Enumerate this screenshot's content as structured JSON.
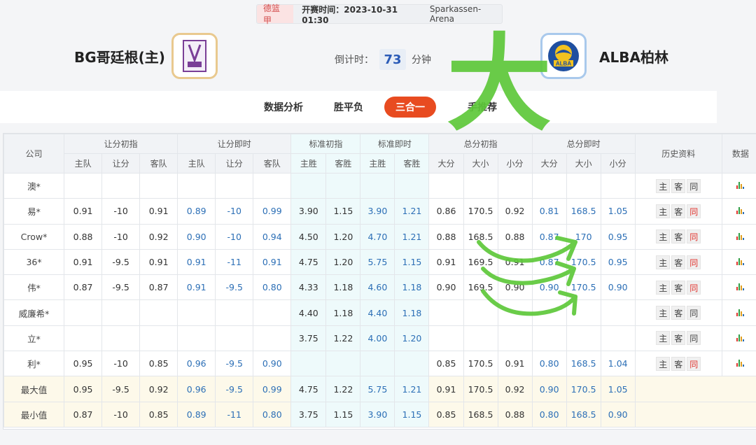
{
  "match": {
    "league": "德篮甲",
    "kickoff_label": "开赛时间：",
    "kickoff": "2023-10-31 01:30",
    "venue": "Sparkassen-Arena"
  },
  "home": {
    "name": "BG哥廷根(主)"
  },
  "away": {
    "name": "ALBA柏林",
    "logo_text": "ALBA"
  },
  "countdown": {
    "label": "倒计时：",
    "value": "73",
    "unit": "分钟"
  },
  "tabs": [
    {
      "label": "数据分析",
      "active": false
    },
    {
      "label": "胜平负",
      "active": false
    },
    {
      "label": "三合一",
      "active": true
    },
    {
      "label": "手推荐",
      "active": false
    }
  ],
  "annotation": {
    "text": "大",
    "color": "#5ec83a"
  },
  "table": {
    "groups": [
      "公司",
      "让分初指",
      "让分即时",
      "标准初指",
      "标准即时",
      "总分初指",
      "总分即时",
      "历史资料",
      "数据"
    ],
    "subheaders": [
      "主队",
      "让分",
      "客队",
      "主队",
      "让分",
      "客队",
      "主胜",
      "客胜",
      "主胜",
      "客胜",
      "大分",
      "大小",
      "小分",
      "大分",
      "大小",
      "小分"
    ],
    "history_buttons": [
      "主",
      "客",
      "同"
    ],
    "rows": [
      {
        "company": "澳*",
        "cells": [
          "",
          "",
          "",
          "",
          "",
          "",
          "",
          "",
          "",
          "",
          "",
          "",
          "",
          "",
          "",
          ""
        ]
      },
      {
        "company": "易*",
        "cells": [
          "0.91",
          "-10",
          "0.91",
          "0.89",
          "-10",
          "0.99",
          "3.90",
          "1.15",
          "3.90",
          "1.21",
          "0.86",
          "170.5",
          "0.92",
          "0.81",
          "168.5",
          "1.05"
        ]
      },
      {
        "company": "Crow*",
        "cells": [
          "0.88",
          "-10",
          "0.92",
          "0.90",
          "-10",
          "0.94",
          "4.50",
          "1.20",
          "4.70",
          "1.21",
          "0.88",
          "168.5",
          "0.88",
          "0.87",
          "170",
          "0.95"
        ]
      },
      {
        "company": "36*",
        "cells": [
          "0.91",
          "-9.5",
          "0.91",
          "0.91",
          "-11",
          "0.91",
          "4.75",
          "1.20",
          "5.75",
          "1.15",
          "0.91",
          "169.5",
          "0.91",
          "0.87",
          "170.5",
          "0.95"
        ]
      },
      {
        "company": "伟*",
        "cells": [
          "0.87",
          "-9.5",
          "0.87",
          "0.91",
          "-9.5",
          "0.80",
          "4.33",
          "1.18",
          "4.60",
          "1.18",
          "0.90",
          "169.5",
          "0.90",
          "0.90",
          "170.5",
          "0.90"
        ]
      },
      {
        "company": "威廉希*",
        "cells": [
          "",
          "",
          "",
          "",
          "",
          "",
          "4.40",
          "1.18",
          "4.40",
          "1.18",
          "",
          "",
          "",
          "",
          "",
          ""
        ]
      },
      {
        "company": "立*",
        "cells": [
          "",
          "",
          "",
          "",
          "",
          "",
          "3.75",
          "1.22",
          "4.00",
          "1.20",
          "",
          "",
          "",
          "",
          "",
          ""
        ]
      },
      {
        "company": "利*",
        "cells": [
          "0.95",
          "-10",
          "0.85",
          "0.96",
          "-9.5",
          "0.90",
          "",
          "",
          "",
          "",
          "0.85",
          "170.5",
          "0.91",
          "0.80",
          "168.5",
          "1.04"
        ]
      }
    ],
    "summary": [
      {
        "label": "最大值",
        "cells": [
          "0.95",
          "-9.5",
          "0.92",
          "0.96",
          "-9.5",
          "0.99",
          "4.75",
          "1.22",
          "5.75",
          "1.21",
          "0.91",
          "170.5",
          "0.92",
          "0.90",
          "170.5",
          "1.05"
        ]
      },
      {
        "label": "最小值",
        "cells": [
          "0.87",
          "-10",
          "0.85",
          "0.89",
          "-11",
          "0.80",
          "3.75",
          "1.15",
          "3.90",
          "1.15",
          "0.85",
          "168.5",
          "0.88",
          "0.80",
          "168.5",
          "0.90"
        ]
      }
    ]
  }
}
